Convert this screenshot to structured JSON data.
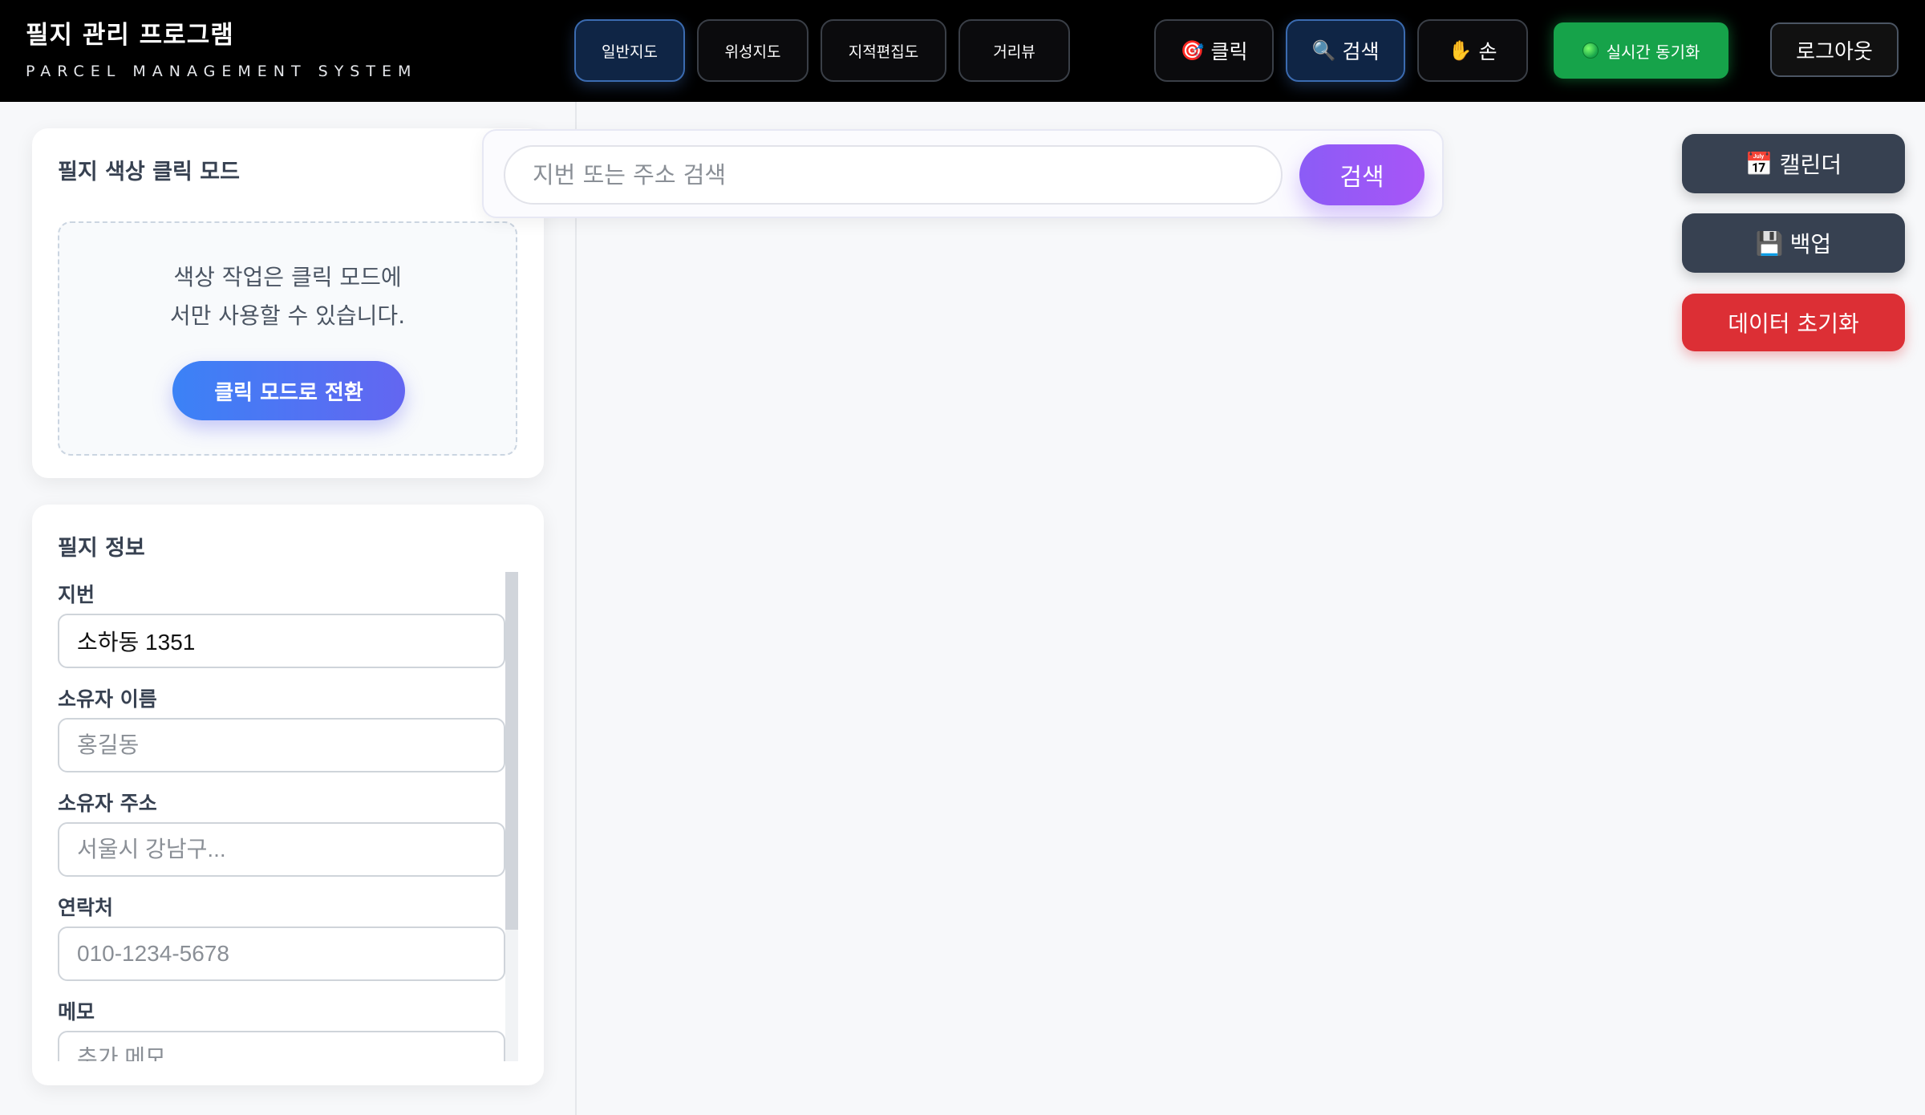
{
  "header": {
    "title": "필지 관리 프로그램",
    "subtitle": "PARCEL MANAGEMENT SYSTEM",
    "map_types": [
      {
        "label": "일반지도",
        "active": true
      },
      {
        "label": "위성지도",
        "active": false
      },
      {
        "label": "지적편집도",
        "active": false
      },
      {
        "label": "거리뷰",
        "active": false
      }
    ],
    "modes": [
      {
        "icon": "🎯",
        "icon_name": "target-icon",
        "label": "클릭",
        "active": false
      },
      {
        "icon": "🔍",
        "icon_name": "search-icon",
        "label": "검색",
        "active": true
      },
      {
        "icon": "✋",
        "icon_name": "hand-icon",
        "label": "손",
        "active": false
      }
    ],
    "sync_label": "실시간 동기화",
    "logout_label": "로그아웃"
  },
  "color_panel": {
    "title": "필지 색상 클릭 모드",
    "notice_line1": "색상 작업은 클릭 모드에",
    "notice_line2": "서만 사용할 수 있습니다.",
    "switch_button": "클릭 모드로 전환"
  },
  "info_panel": {
    "title": "필지 정보",
    "fields": [
      {
        "label": "지번",
        "value": "소하동 1351",
        "placeholder": ""
      },
      {
        "label": "소유자 이름",
        "value": "",
        "placeholder": "홍길동"
      },
      {
        "label": "소유자 주소",
        "value": "",
        "placeholder": "서울시 강남구..."
      },
      {
        "label": "연락처",
        "value": "",
        "placeholder": "010-1234-5678"
      },
      {
        "label": "메모",
        "value": "",
        "placeholder": "추가 메모"
      }
    ]
  },
  "search": {
    "placeholder": "지번 또는 주소 검색",
    "button": "검색"
  },
  "side_actions": {
    "calendar_icon": "📅",
    "calendar_label": "캘린더",
    "backup_icon": "💾",
    "backup_label": "백업",
    "reset_label": "데이터 초기화"
  },
  "colors": {
    "header_bg": "#000000",
    "active_button": "#0f2545",
    "sync_green": "#16a34a",
    "search_purple": "#8b5cf6",
    "switch_blue": "#3b82f6",
    "danger_red": "#dc2f35"
  }
}
